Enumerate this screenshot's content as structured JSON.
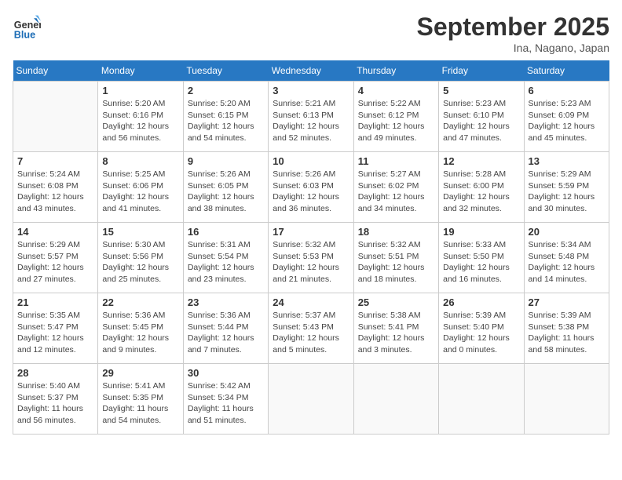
{
  "header": {
    "logo_line1": "General",
    "logo_line2": "Blue",
    "month": "September 2025",
    "location": "Ina, Nagano, Japan"
  },
  "weekdays": [
    "Sunday",
    "Monday",
    "Tuesday",
    "Wednesday",
    "Thursday",
    "Friday",
    "Saturday"
  ],
  "weeks": [
    [
      null,
      {
        "day": "1",
        "sunrise": "Sunrise: 5:20 AM",
        "sunset": "Sunset: 6:16 PM",
        "daylight": "Daylight: 12 hours and 56 minutes."
      },
      {
        "day": "2",
        "sunrise": "Sunrise: 5:20 AM",
        "sunset": "Sunset: 6:15 PM",
        "daylight": "Daylight: 12 hours and 54 minutes."
      },
      {
        "day": "3",
        "sunrise": "Sunrise: 5:21 AM",
        "sunset": "Sunset: 6:13 PM",
        "daylight": "Daylight: 12 hours and 52 minutes."
      },
      {
        "day": "4",
        "sunrise": "Sunrise: 5:22 AM",
        "sunset": "Sunset: 6:12 PM",
        "daylight": "Daylight: 12 hours and 49 minutes."
      },
      {
        "day": "5",
        "sunrise": "Sunrise: 5:23 AM",
        "sunset": "Sunset: 6:10 PM",
        "daylight": "Daylight: 12 hours and 47 minutes."
      },
      {
        "day": "6",
        "sunrise": "Sunrise: 5:23 AM",
        "sunset": "Sunset: 6:09 PM",
        "daylight": "Daylight: 12 hours and 45 minutes."
      }
    ],
    [
      {
        "day": "7",
        "sunrise": "Sunrise: 5:24 AM",
        "sunset": "Sunset: 6:08 PM",
        "daylight": "Daylight: 12 hours and 43 minutes."
      },
      {
        "day": "8",
        "sunrise": "Sunrise: 5:25 AM",
        "sunset": "Sunset: 6:06 PM",
        "daylight": "Daylight: 12 hours and 41 minutes."
      },
      {
        "day": "9",
        "sunrise": "Sunrise: 5:26 AM",
        "sunset": "Sunset: 6:05 PM",
        "daylight": "Daylight: 12 hours and 38 minutes."
      },
      {
        "day": "10",
        "sunrise": "Sunrise: 5:26 AM",
        "sunset": "Sunset: 6:03 PM",
        "daylight": "Daylight: 12 hours and 36 minutes."
      },
      {
        "day": "11",
        "sunrise": "Sunrise: 5:27 AM",
        "sunset": "Sunset: 6:02 PM",
        "daylight": "Daylight: 12 hours and 34 minutes."
      },
      {
        "day": "12",
        "sunrise": "Sunrise: 5:28 AM",
        "sunset": "Sunset: 6:00 PM",
        "daylight": "Daylight: 12 hours and 32 minutes."
      },
      {
        "day": "13",
        "sunrise": "Sunrise: 5:29 AM",
        "sunset": "Sunset: 5:59 PM",
        "daylight": "Daylight: 12 hours and 30 minutes."
      }
    ],
    [
      {
        "day": "14",
        "sunrise": "Sunrise: 5:29 AM",
        "sunset": "Sunset: 5:57 PM",
        "daylight": "Daylight: 12 hours and 27 minutes."
      },
      {
        "day": "15",
        "sunrise": "Sunrise: 5:30 AM",
        "sunset": "Sunset: 5:56 PM",
        "daylight": "Daylight: 12 hours and 25 minutes."
      },
      {
        "day": "16",
        "sunrise": "Sunrise: 5:31 AM",
        "sunset": "Sunset: 5:54 PM",
        "daylight": "Daylight: 12 hours and 23 minutes."
      },
      {
        "day": "17",
        "sunrise": "Sunrise: 5:32 AM",
        "sunset": "Sunset: 5:53 PM",
        "daylight": "Daylight: 12 hours and 21 minutes."
      },
      {
        "day": "18",
        "sunrise": "Sunrise: 5:32 AM",
        "sunset": "Sunset: 5:51 PM",
        "daylight": "Daylight: 12 hours and 18 minutes."
      },
      {
        "day": "19",
        "sunrise": "Sunrise: 5:33 AM",
        "sunset": "Sunset: 5:50 PM",
        "daylight": "Daylight: 12 hours and 16 minutes."
      },
      {
        "day": "20",
        "sunrise": "Sunrise: 5:34 AM",
        "sunset": "Sunset: 5:48 PM",
        "daylight": "Daylight: 12 hours and 14 minutes."
      }
    ],
    [
      {
        "day": "21",
        "sunrise": "Sunrise: 5:35 AM",
        "sunset": "Sunset: 5:47 PM",
        "daylight": "Daylight: 12 hours and 12 minutes."
      },
      {
        "day": "22",
        "sunrise": "Sunrise: 5:36 AM",
        "sunset": "Sunset: 5:45 PM",
        "daylight": "Daylight: 12 hours and 9 minutes."
      },
      {
        "day": "23",
        "sunrise": "Sunrise: 5:36 AM",
        "sunset": "Sunset: 5:44 PM",
        "daylight": "Daylight: 12 hours and 7 minutes."
      },
      {
        "day": "24",
        "sunrise": "Sunrise: 5:37 AM",
        "sunset": "Sunset: 5:43 PM",
        "daylight": "Daylight: 12 hours and 5 minutes."
      },
      {
        "day": "25",
        "sunrise": "Sunrise: 5:38 AM",
        "sunset": "Sunset: 5:41 PM",
        "daylight": "Daylight: 12 hours and 3 minutes."
      },
      {
        "day": "26",
        "sunrise": "Sunrise: 5:39 AM",
        "sunset": "Sunset: 5:40 PM",
        "daylight": "Daylight: 12 hours and 0 minutes."
      },
      {
        "day": "27",
        "sunrise": "Sunrise: 5:39 AM",
        "sunset": "Sunset: 5:38 PM",
        "daylight": "Daylight: 11 hours and 58 minutes."
      }
    ],
    [
      {
        "day": "28",
        "sunrise": "Sunrise: 5:40 AM",
        "sunset": "Sunset: 5:37 PM",
        "daylight": "Daylight: 11 hours and 56 minutes."
      },
      {
        "day": "29",
        "sunrise": "Sunrise: 5:41 AM",
        "sunset": "Sunset: 5:35 PM",
        "daylight": "Daylight: 11 hours and 54 minutes."
      },
      {
        "day": "30",
        "sunrise": "Sunrise: 5:42 AM",
        "sunset": "Sunset: 5:34 PM",
        "daylight": "Daylight: 11 hours and 51 minutes."
      },
      null,
      null,
      null,
      null
    ]
  ]
}
